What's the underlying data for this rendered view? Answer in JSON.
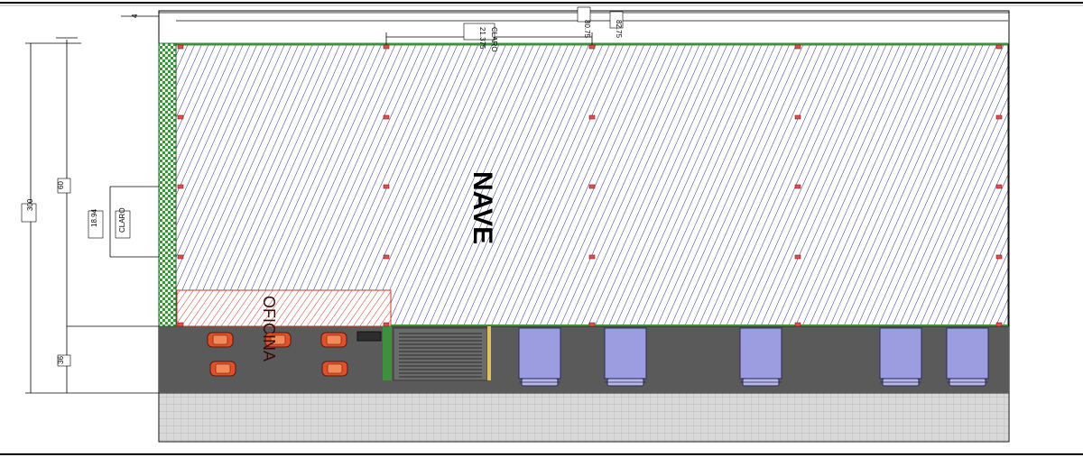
{
  "plan": {
    "labels": {
      "warehouse": "NAVE",
      "office": "OFICINA"
    },
    "dimensions": {
      "total_width_outer": "80.75",
      "total_width_inner": "82.75",
      "bay_spacing": "21.375",
      "bay_spacing_note": "CLARO",
      "depth_total": "300",
      "depth_building": "60",
      "depth_yard": "36",
      "depth_bay": "18.94",
      "depth_bay_note": "CLARO",
      "corner_tag": "4"
    },
    "counts": {
      "cars": 5,
      "trucks": 5
    },
    "colors": {
      "warehouse_hatch": "#2a2f8f",
      "office_hatch": "#c0392b",
      "yard": "#5a5a5a",
      "sidewalk": "#d8d8d8",
      "truck_body": "#9c9ce0",
      "car_body": "#e0502a",
      "wall_green": "#3f8f3f"
    }
  }
}
